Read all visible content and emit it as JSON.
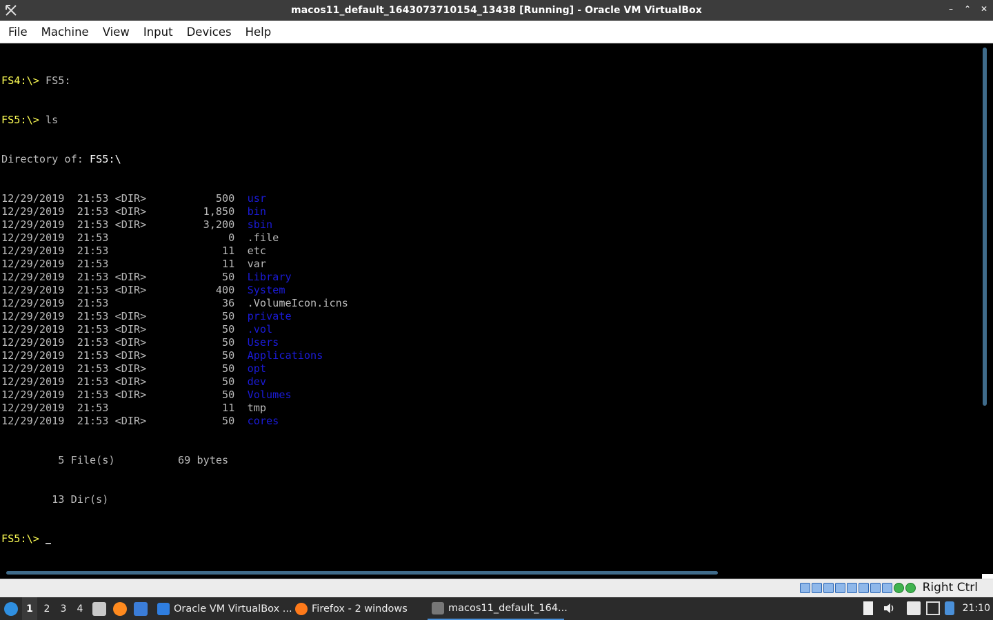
{
  "window": {
    "title": "macos11_default_1643073710154_13438 [Running] - Oracle VM VirtualBox",
    "controls": [
      "–",
      "⌃",
      "✕"
    ]
  },
  "menu": [
    "File",
    "Machine",
    "View",
    "Input",
    "Devices",
    "Help"
  ],
  "terminal": {
    "line1_prompt": "FS4:\\>",
    "line1_cmd": " FS5:",
    "line2_prompt": "FS5:\\>",
    "line2_cmd": " ls",
    "dir_label": "Directory of: ",
    "dir_path": "FS5:\\",
    "entries": [
      {
        "date": "12/29/2019",
        "time": "21:53",
        "type": "<DIR>",
        "size": "500",
        "name": "usr",
        "is_dir": true
      },
      {
        "date": "12/29/2019",
        "time": "21:53",
        "type": "<DIR>",
        "size": "1,850",
        "name": "bin",
        "is_dir": true
      },
      {
        "date": "12/29/2019",
        "time": "21:53",
        "type": "<DIR>",
        "size": "3,200",
        "name": "sbin",
        "is_dir": true
      },
      {
        "date": "12/29/2019",
        "time": "21:53",
        "type": "",
        "size": "0",
        "name": ".file",
        "is_dir": false
      },
      {
        "date": "12/29/2019",
        "time": "21:53",
        "type": "",
        "size": "11",
        "name": "etc",
        "is_dir": false
      },
      {
        "date": "12/29/2019",
        "time": "21:53",
        "type": "",
        "size": "11",
        "name": "var",
        "is_dir": false
      },
      {
        "date": "12/29/2019",
        "time": "21:53",
        "type": "<DIR>",
        "size": "50",
        "name": "Library",
        "is_dir": true
      },
      {
        "date": "12/29/2019",
        "time": "21:53",
        "type": "<DIR>",
        "size": "400",
        "name": "System",
        "is_dir": true
      },
      {
        "date": "12/29/2019",
        "time": "21:53",
        "type": "",
        "size": "36",
        "name": ".VolumeIcon.icns",
        "is_dir": false
      },
      {
        "date": "12/29/2019",
        "time": "21:53",
        "type": "<DIR>",
        "size": "50",
        "name": "private",
        "is_dir": true
      },
      {
        "date": "12/29/2019",
        "time": "21:53",
        "type": "<DIR>",
        "size": "50",
        "name": ".vol",
        "is_dir": true
      },
      {
        "date": "12/29/2019",
        "time": "21:53",
        "type": "<DIR>",
        "size": "50",
        "name": "Users",
        "is_dir": true
      },
      {
        "date": "12/29/2019",
        "time": "21:53",
        "type": "<DIR>",
        "size": "50",
        "name": "Applications",
        "is_dir": true
      },
      {
        "date": "12/29/2019",
        "time": "21:53",
        "type": "<DIR>",
        "size": "50",
        "name": "opt",
        "is_dir": true
      },
      {
        "date": "12/29/2019",
        "time": "21:53",
        "type": "<DIR>",
        "size": "50",
        "name": "dev",
        "is_dir": true
      },
      {
        "date": "12/29/2019",
        "time": "21:53",
        "type": "<DIR>",
        "size": "50",
        "name": "Volumes",
        "is_dir": true
      },
      {
        "date": "12/29/2019",
        "time": "21:53",
        "type": "",
        "size": "11",
        "name": "tmp",
        "is_dir": false
      },
      {
        "date": "12/29/2019",
        "time": "21:53",
        "type": "<DIR>",
        "size": "50",
        "name": "cores",
        "is_dir": true
      }
    ],
    "summary_files": "         5 File(s)          69 bytes",
    "summary_dirs": "        13 Dir(s)",
    "final_prompt": "FS5:\\>"
  },
  "statusbar": {
    "host_key": "Right Ctrl",
    "icons": [
      "hard-disk-icon",
      "optical-drive-icon",
      "audio-icon",
      "network-icon",
      "usb-icon",
      "shared-folders-icon",
      "display-icon",
      "video-capture-icon",
      "mouse-integration-icon",
      "cpu-icon"
    ]
  },
  "taskbar": {
    "workspaces": [
      "1",
      "2",
      "3",
      "4"
    ],
    "tasks": [
      {
        "label": "Oracle VM VirtualBox ...",
        "icon": "virtualbox-icon"
      },
      {
        "label": "Firefox - 2 windows",
        "icon": "firefox-icon"
      },
      {
        "label": "macos11_default_164...",
        "icon": "virtualbox-vm-icon"
      }
    ],
    "clock": "21:10"
  },
  "colors": {
    "prompt": "#ffff55",
    "dir_name": "#1b1bd8",
    "text": "#bbbbbb",
    "titlebar": "#3c3c3c",
    "taskbar": "#2b2b2b"
  }
}
